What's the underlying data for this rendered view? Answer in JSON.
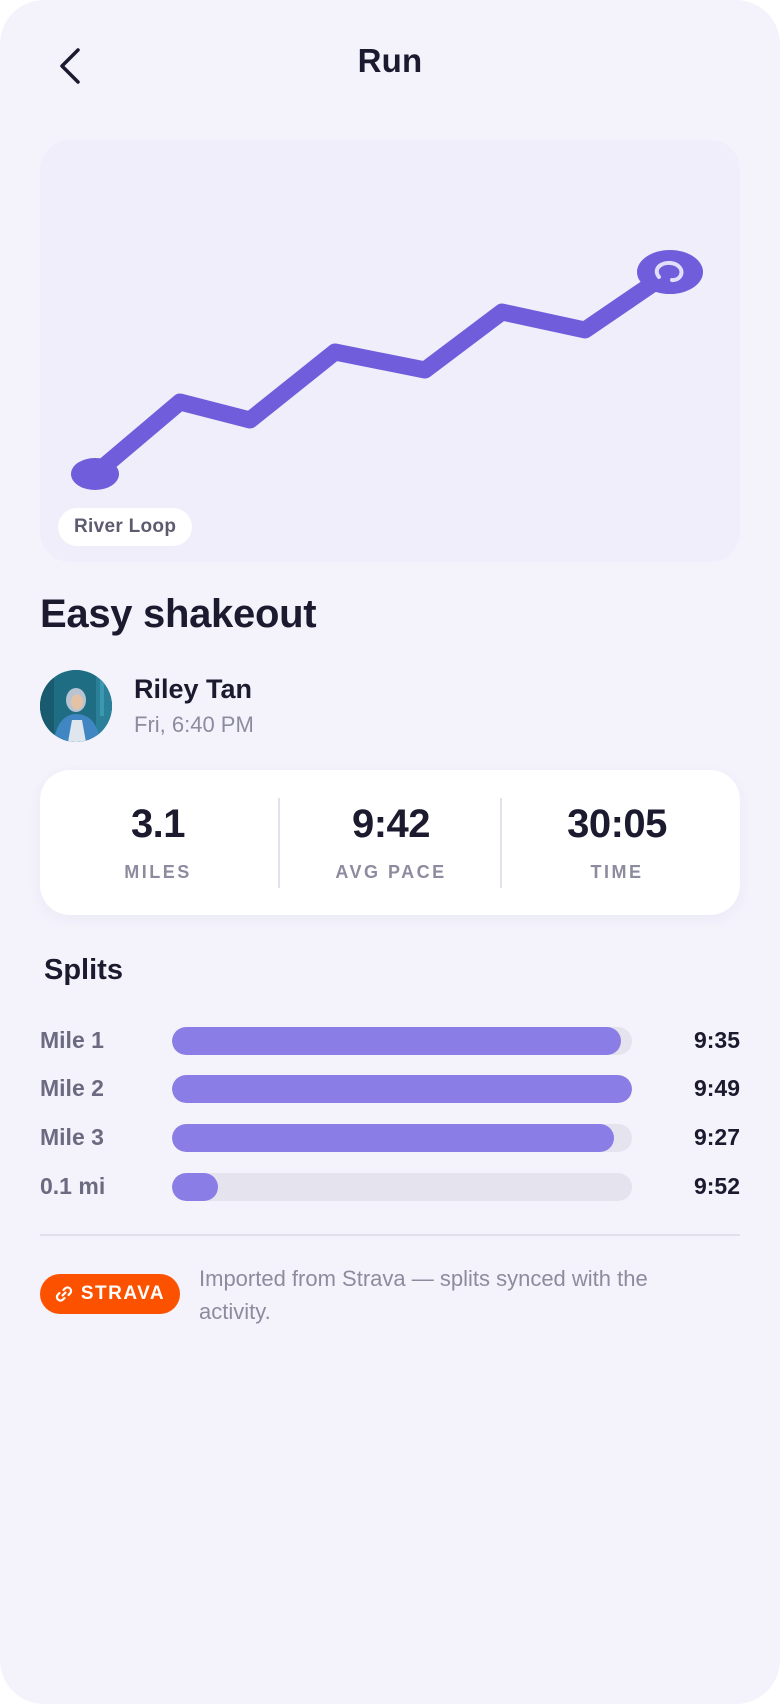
{
  "header": {
    "title": "Run"
  },
  "map": {
    "route_name": "River Loop",
    "route_color": "#6f5ddc"
  },
  "activity": {
    "title": "Easy shakeout"
  },
  "athlete": {
    "name": "Riley Tan",
    "time": "Fri, 6:40 PM"
  },
  "stats": [
    {
      "value": "3.1",
      "label": "MILES"
    },
    {
      "value": "9:42",
      "label": "AVG PACE"
    },
    {
      "value": "30:05",
      "label": "TIME"
    }
  ],
  "splits": {
    "title": "Splits",
    "bar_color": "#8a7ee6",
    "rows": [
      {
        "label": "Mile 1",
        "time": "9:35",
        "fill_fraction": 0.975
      },
      {
        "label": "Mile 2",
        "time": "9:49",
        "fill_fraction": 1.0
      },
      {
        "label": "Mile 3",
        "time": "9:27",
        "fill_fraction": 0.96
      },
      {
        "label": "0.1 mi",
        "time": "9:52",
        "fill_fraction": 0.1
      }
    ]
  },
  "footer": {
    "badge": "STRAVA",
    "badge_color": "#fc5200",
    "note": "Imported from Strava — splits synced with the activity."
  }
}
